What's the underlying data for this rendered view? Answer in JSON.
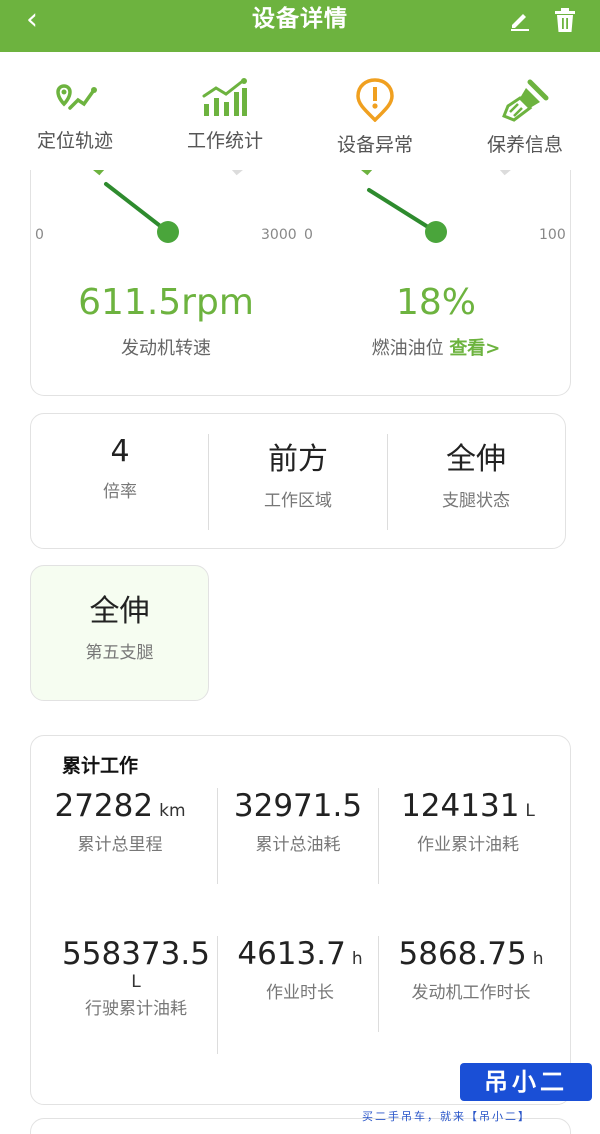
{
  "header": {
    "title": "设备详情",
    "accent": "#6db33f"
  },
  "quick_actions": [
    {
      "label": "定位轨迹",
      "icon": "route-icon"
    },
    {
      "label": "工作统计",
      "icon": "statistics-chart-icon"
    },
    {
      "label": "设备异常",
      "icon": "warning-icon"
    },
    {
      "label": "保养信息",
      "icon": "brush-icon"
    }
  ],
  "gauges": {
    "engine": {
      "min": "0",
      "max": "3000",
      "value": "611.5rpm",
      "label": "发动机转速",
      "fraction": 0.2
    },
    "fuel": {
      "min": "0",
      "max": "100",
      "value": "18%",
      "label": "燃油油位",
      "link": "查看>",
      "fraction": 0.18
    }
  },
  "status": [
    {
      "value": "4",
      "label": "倍率"
    },
    {
      "value": "前方",
      "label": "工作区域"
    },
    {
      "value": "全伸",
      "label": "支腿状态"
    }
  ],
  "fifth_leg": {
    "value": "全伸",
    "label": "第五支腿"
  },
  "cumulative": {
    "heading": "累计工作",
    "items": [
      {
        "value": "27282",
        "unit": "km",
        "label": "累计总里程"
      },
      {
        "value": "32971.5",
        "unit": "",
        "label": "累计总油耗"
      },
      {
        "value": "124131",
        "unit": "L",
        "label": "作业累计油耗"
      },
      {
        "value": "558373.5",
        "unit": "L",
        "label": "行驶累计油耗"
      },
      {
        "value": "4613.7",
        "unit": "h",
        "label": "作业时长"
      },
      {
        "value": "5868.75",
        "unit": "h",
        "label": "发动机工作时长"
      }
    ]
  },
  "watermark": {
    "title": "吊小二",
    "subtitle": "买二手吊车，就来【吊小二】"
  }
}
